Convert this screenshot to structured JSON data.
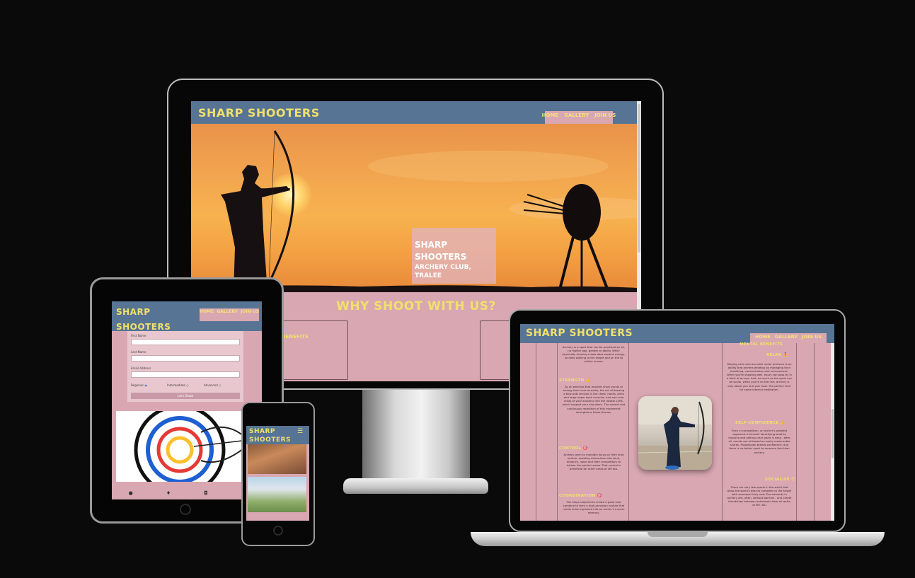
{
  "site": {
    "brand": "SHARP SHOOTERS",
    "nav": [
      "HOME",
      "GALLERY",
      "JOIN US"
    ]
  },
  "desktop": {
    "hero_title_line1": "SHARP",
    "hero_title_line2": "SHOOTERS",
    "hero_sub_line1": "ARCHERY CLUB,",
    "hero_sub_line2": "TRALEE",
    "section_heading": "WHY SHOOT WITH US?",
    "box_heading": "BENEFITS"
  },
  "tablet": {
    "brand_line1": "SHARP",
    "brand_line2": "SHOOTERS",
    "form": {
      "first_name": "First Name",
      "last_name": "Last Name",
      "email": "Email Address",
      "levels": [
        "Beginner",
        "Intermediate",
        "Advanced"
      ],
      "submit": "Let's Shoot"
    },
    "footer_icons": [
      "facebook-icon",
      "twitter-icon",
      "instagram-icon",
      "youtube-icon"
    ]
  },
  "phone": {
    "brand_line1": "SHARP",
    "brand_line2": "SHOOTERS",
    "menu_icon": "hamburger-icon"
  },
  "laptop": {
    "sections_left": [
      {
        "heading": "",
        "text": "Archery is a sport that can be practised by all, no matter age, gender or ability. While physically drawing a bow does expend energy, so does walking to the target and on the to collect arrows."
      },
      {
        "heading": "STRENGTH 💪",
        "text": "As an exercise that requires short bursts of energy from core muscles, the act of drawing a bow puts tension in the chest, hands, arms and large upper back muscles, and non-core areas of your anatomy like the rotator cuffs, which support your shoulders. The correct and continuous repetition of this movement strengthens these tissues."
      },
      {
        "heading": "CONTROL 🎯",
        "text": "Archers learn to maintain focus on their shot routine, avoiding distractions like wind, distance, noise and their competitors to deliver the perfect arrow. That control is beneficial for other areas of life too."
      },
      {
        "heading": "COORDINATION 🎯",
        "text": "The steps required to create a good shot combine to form a high-precision routine that needs to be ingrained into an archer's muscle memory."
      }
    ],
    "sections_right": [
      {
        "heading": "MENTAL BENEFITS",
        "text": ""
      },
      {
        "heading": "RELAX 🧘",
        "text": "Staying calm and accurate under pressure is an ability that archers develop by managing their breathing, concentration and nervousness. When you're shooting well, hours can pass by in a blink of an eye. And, as much as the sport can be social, when you're on the line, archery is only about you and your bow. The perfect time for some internal meditation."
      },
      {
        "heading": "SELF-CONFIDENCE 👍",
        "text": "Even in competition, an archer's greatest opponent is himself. Identifying what to improve and setting clear goals is easy - after all, results are all based on easily measurable scores. Progression breeds confidence, and there is no better sport to measure that than archery."
      },
      {
        "heading": "SOCIALISE 😊",
        "text": "There are very few sports in the world that allow the world's best to compete on the target with someone fairly new. Tournaments in archery are, often, without barriers - and create friendships between individuals from all walks of life. You"
      }
    ]
  },
  "colors": {
    "background": "#0b0a0a",
    "header": "#577494",
    "page_pink": "#d9a7b2",
    "brand_yellow": "#f1e06c"
  }
}
